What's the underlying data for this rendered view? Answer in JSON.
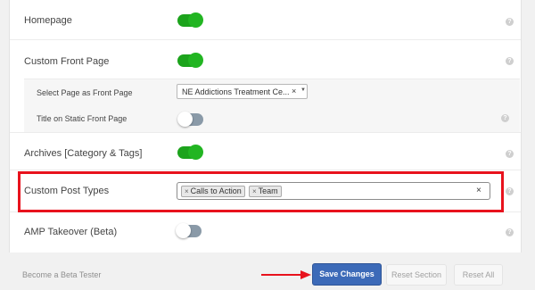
{
  "settings": {
    "homepage": {
      "label": "Homepage",
      "enabled": true
    },
    "custom_front_page": {
      "label": "Custom Front Page",
      "enabled": true,
      "select_page": {
        "label": "Select Page as Front Page",
        "value": "NE Addictions Treatment Ce...",
        "clear": "×"
      },
      "title_static": {
        "label": "Title on Static Front Page",
        "enabled": false
      }
    },
    "archives": {
      "label": "Archives [Category & Tags]",
      "enabled": true
    },
    "custom_post_types": {
      "label": "Custom Post Types",
      "tags": [
        "Calls to Action",
        "Team"
      ],
      "clear": "×"
    },
    "amp_takeover": {
      "label": "AMP Takeover (Beta)",
      "enabled": false
    },
    "help_glyph": "?"
  },
  "footer": {
    "beta_link": "Become a Beta Tester",
    "save_label": "Save Changes",
    "reset_section_label": "Reset Section",
    "reset_all_label": "Reset All"
  },
  "colors": {
    "toggle_on": "#1ca31c",
    "toggle_off": "#8a9aa8",
    "primary_button": "#3c6ab8",
    "highlight": "#e8121d"
  },
  "icons": {
    "help": "question-circle-icon",
    "tag_remove": "close-icon",
    "select_caret": "caret-down-icon",
    "annotation": "arrow-right-icon"
  }
}
